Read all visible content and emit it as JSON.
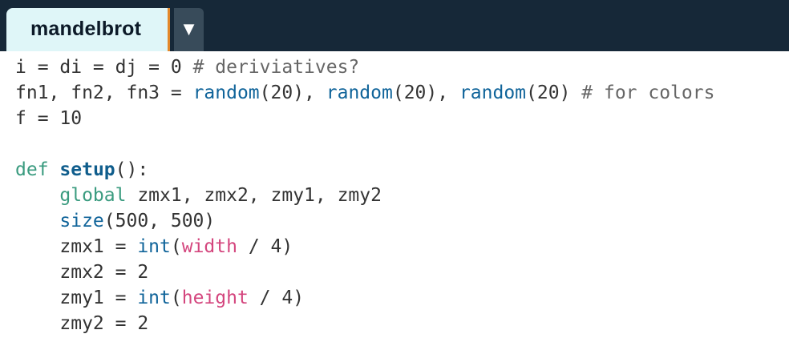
{
  "tab": {
    "label": "mandelbrot",
    "menu_icon": "▼"
  },
  "code": {
    "lines": [
      {
        "tokens": [
          {
            "t": "i = di = dj = 0 ",
            "c": "plain"
          },
          {
            "t": "# deriviatives?",
            "c": "comment"
          }
        ]
      },
      {
        "tokens": [
          {
            "t": "fn1, fn2, fn3 = ",
            "c": "plain"
          },
          {
            "t": "random",
            "c": "builtin"
          },
          {
            "t": "(20), ",
            "c": "plain"
          },
          {
            "t": "random",
            "c": "builtin"
          },
          {
            "t": "(20), ",
            "c": "plain"
          },
          {
            "t": "random",
            "c": "builtin"
          },
          {
            "t": "(20) ",
            "c": "plain"
          },
          {
            "t": "# for colors",
            "c": "comment"
          }
        ]
      },
      {
        "tokens": [
          {
            "t": "f = 10",
            "c": "plain"
          }
        ]
      },
      {
        "tokens": []
      },
      {
        "tokens": [
          {
            "t": "def",
            "c": "keyword"
          },
          {
            "t": " ",
            "c": "plain"
          },
          {
            "t": "setup",
            "c": "defname"
          },
          {
            "t": "():",
            "c": "plain"
          }
        ]
      },
      {
        "tokens": [
          {
            "t": "    ",
            "c": "plain"
          },
          {
            "t": "global",
            "c": "keyword"
          },
          {
            "t": " zmx1, zmx2, zmy1, zmy2",
            "c": "plain"
          }
        ]
      },
      {
        "tokens": [
          {
            "t": "    ",
            "c": "plain"
          },
          {
            "t": "size",
            "c": "builtin"
          },
          {
            "t": "(500, 500)",
            "c": "plain"
          }
        ]
      },
      {
        "tokens": [
          {
            "t": "    zmx1 = ",
            "c": "plain"
          },
          {
            "t": "int",
            "c": "builtin"
          },
          {
            "t": "(",
            "c": "plain"
          },
          {
            "t": "width",
            "c": "variable"
          },
          {
            "t": " / 4)",
            "c": "plain"
          }
        ]
      },
      {
        "tokens": [
          {
            "t": "    zmx2 = 2",
            "c": "plain"
          }
        ]
      },
      {
        "tokens": [
          {
            "t": "    zmy1 = ",
            "c": "plain"
          },
          {
            "t": "int",
            "c": "builtin"
          },
          {
            "t": "(",
            "c": "plain"
          },
          {
            "t": "height",
            "c": "variable"
          },
          {
            "t": " / 4)",
            "c": "plain"
          }
        ]
      },
      {
        "tokens": [
          {
            "t": "    zmy2 = 2",
            "c": "plain"
          }
        ]
      }
    ]
  },
  "colors": {
    "topbar": "#162838",
    "tab_background": "#dff6f8",
    "tab_accent": "#e3882a",
    "keyword": "#3a9b7f",
    "defname": "#0f5d8c",
    "builtin": "#10649a",
    "variable": "#d4467e",
    "comment": "#666666",
    "plain": "#333333"
  }
}
